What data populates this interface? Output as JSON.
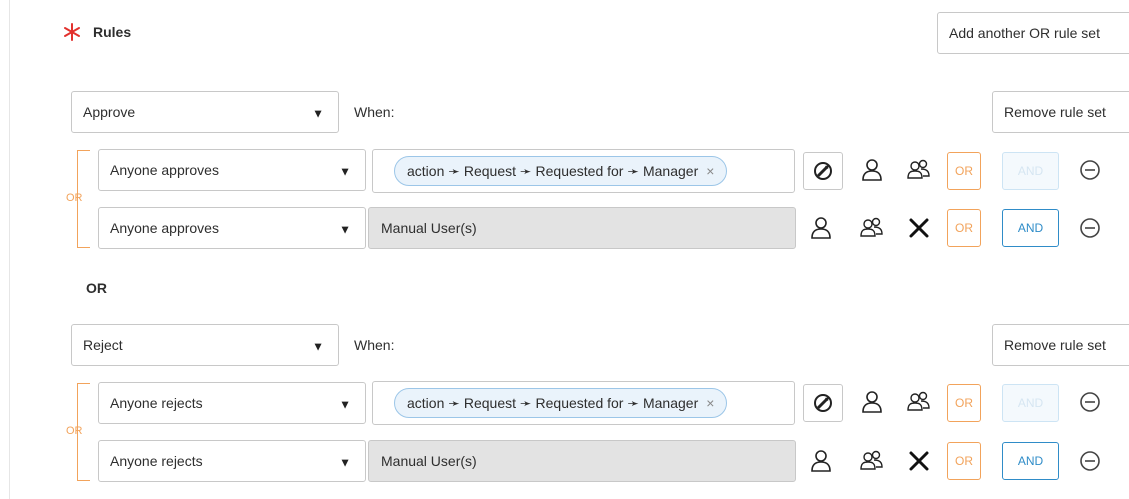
{
  "header": {
    "rules_label": "Rules",
    "required_icon": "asterisk-icon",
    "add_ruleset_label": "Add another OR rule set"
  },
  "rule_sets": [
    {
      "action_value": "Approve",
      "when_label": "When:",
      "remove_label": "Remove rule set",
      "connector_label": "OR",
      "rules": [
        {
          "condition_value": "Anyone approves",
          "pill_text": "action ➛ Request ➛ Requested for ➛ Manager",
          "pill_remove": "×",
          "or_label": "OR",
          "and_label": "AND",
          "and_enabled": false
        },
        {
          "condition_value": "Anyone approves",
          "manual_text": "Manual User(s)",
          "or_label": "OR",
          "and_label": "AND",
          "and_enabled": true
        }
      ]
    },
    {
      "action_value": "Reject",
      "when_label": "When:",
      "remove_label": "Remove rule set",
      "connector_label": "OR",
      "rules": [
        {
          "condition_value": "Anyone rejects",
          "pill_text": "action ➛ Request ➛ Requested for ➛ Manager",
          "pill_remove": "×",
          "or_label": "OR",
          "and_label": "AND",
          "and_enabled": false
        },
        {
          "condition_value": "Anyone rejects",
          "manual_text": "Manual User(s)",
          "or_label": "OR",
          "and_label": "AND",
          "and_enabled": true
        }
      ]
    }
  ],
  "between_sets_label": "OR",
  "colors": {
    "required": "#e2312d",
    "or_accent": "#f2a35b",
    "and_accent": "#2f8cc8",
    "pill_bg": "#eaf3fb",
    "manual_bg": "#e3e3e3"
  }
}
